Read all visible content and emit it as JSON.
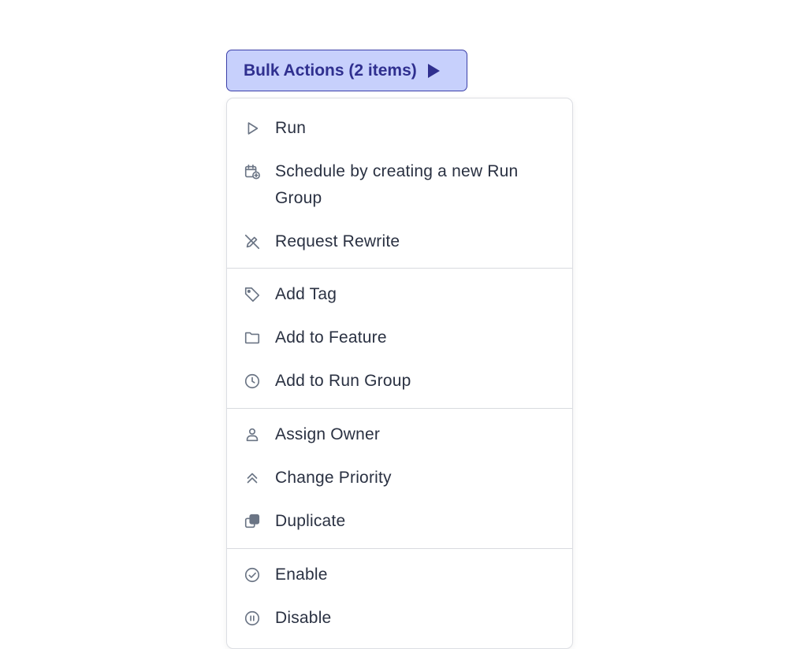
{
  "bulk_button": {
    "label": "Bulk Actions (2 items)"
  },
  "menu": {
    "items": [
      {
        "label": "Run",
        "icon": "play-outline-icon"
      },
      {
        "label": "Schedule by creating a new Run Group",
        "icon": "calendar-plus-icon"
      },
      {
        "label": "Request Rewrite",
        "icon": "pencil-slash-icon"
      },
      {
        "label": "Add Tag",
        "icon": "tag-icon"
      },
      {
        "label": "Add to Feature",
        "icon": "folder-icon"
      },
      {
        "label": "Add to Run Group",
        "icon": "clock-icon"
      },
      {
        "label": "Assign Owner",
        "icon": "user-icon"
      },
      {
        "label": "Change Priority",
        "icon": "chevrons-up-icon"
      },
      {
        "label": "Duplicate",
        "icon": "duplicate-icon"
      },
      {
        "label": "Enable",
        "icon": "check-circle-icon"
      },
      {
        "label": "Disable",
        "icon": "pause-circle-icon"
      }
    ]
  },
  "colors": {
    "button_bg": "#c7d0fc",
    "button_border": "#3b3fa8",
    "button_text": "#2f2f8f",
    "menu_text": "#2a3142",
    "icon": "#6b7585"
  }
}
